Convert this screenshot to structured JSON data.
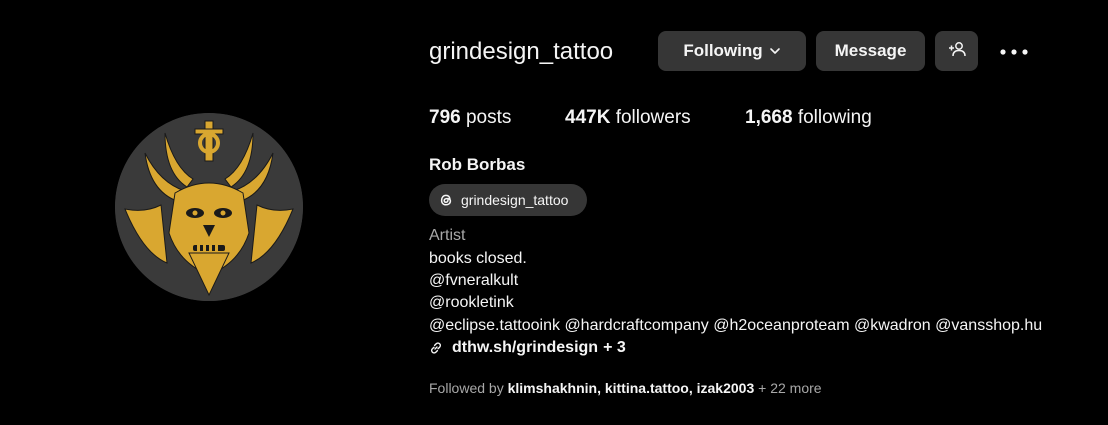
{
  "profile": {
    "username": "grindesign_tattoo",
    "full_name": "Rob Borbas",
    "category": "Artist",
    "avatar_icon": "demon-skull-artwork",
    "avatar_colors": {
      "background": "#3a3a3a",
      "art": "#d9a730"
    }
  },
  "actions": {
    "following_label": "Following",
    "message_label": "Message",
    "add_user_icon": "add-person-icon",
    "more_icon": "more-options-icon"
  },
  "stats": {
    "posts_count": "796",
    "posts_label": "posts",
    "followers_count": "447K",
    "followers_label": "followers",
    "following_count": "1,668",
    "following_label": "following"
  },
  "threads": {
    "label": "grindesign_tattoo",
    "icon": "threads-icon"
  },
  "bio": {
    "line1": "books closed.",
    "line2": "@fvneralkult",
    "line3": "@rookletink",
    "line4_mentions": [
      "@eclipse.tattooink",
      "@hardcraftcompany",
      "@h2oceanproteam",
      "@kwadron",
      "@vansshop.hu"
    ]
  },
  "link": {
    "url_text": "dthw.sh/grindesign",
    "extra": "+ 3",
    "icon": "link-icon"
  },
  "followed_by": {
    "prefix": "Followed by",
    "users": [
      "klimshakhnin",
      "kittina.tattoo",
      "izak2003"
    ],
    "more": "+ 22 more"
  },
  "colors": {
    "background": "#000000",
    "button": "#363636",
    "text_primary": "#f5f5f5",
    "text_secondary": "#a8a8a8"
  }
}
